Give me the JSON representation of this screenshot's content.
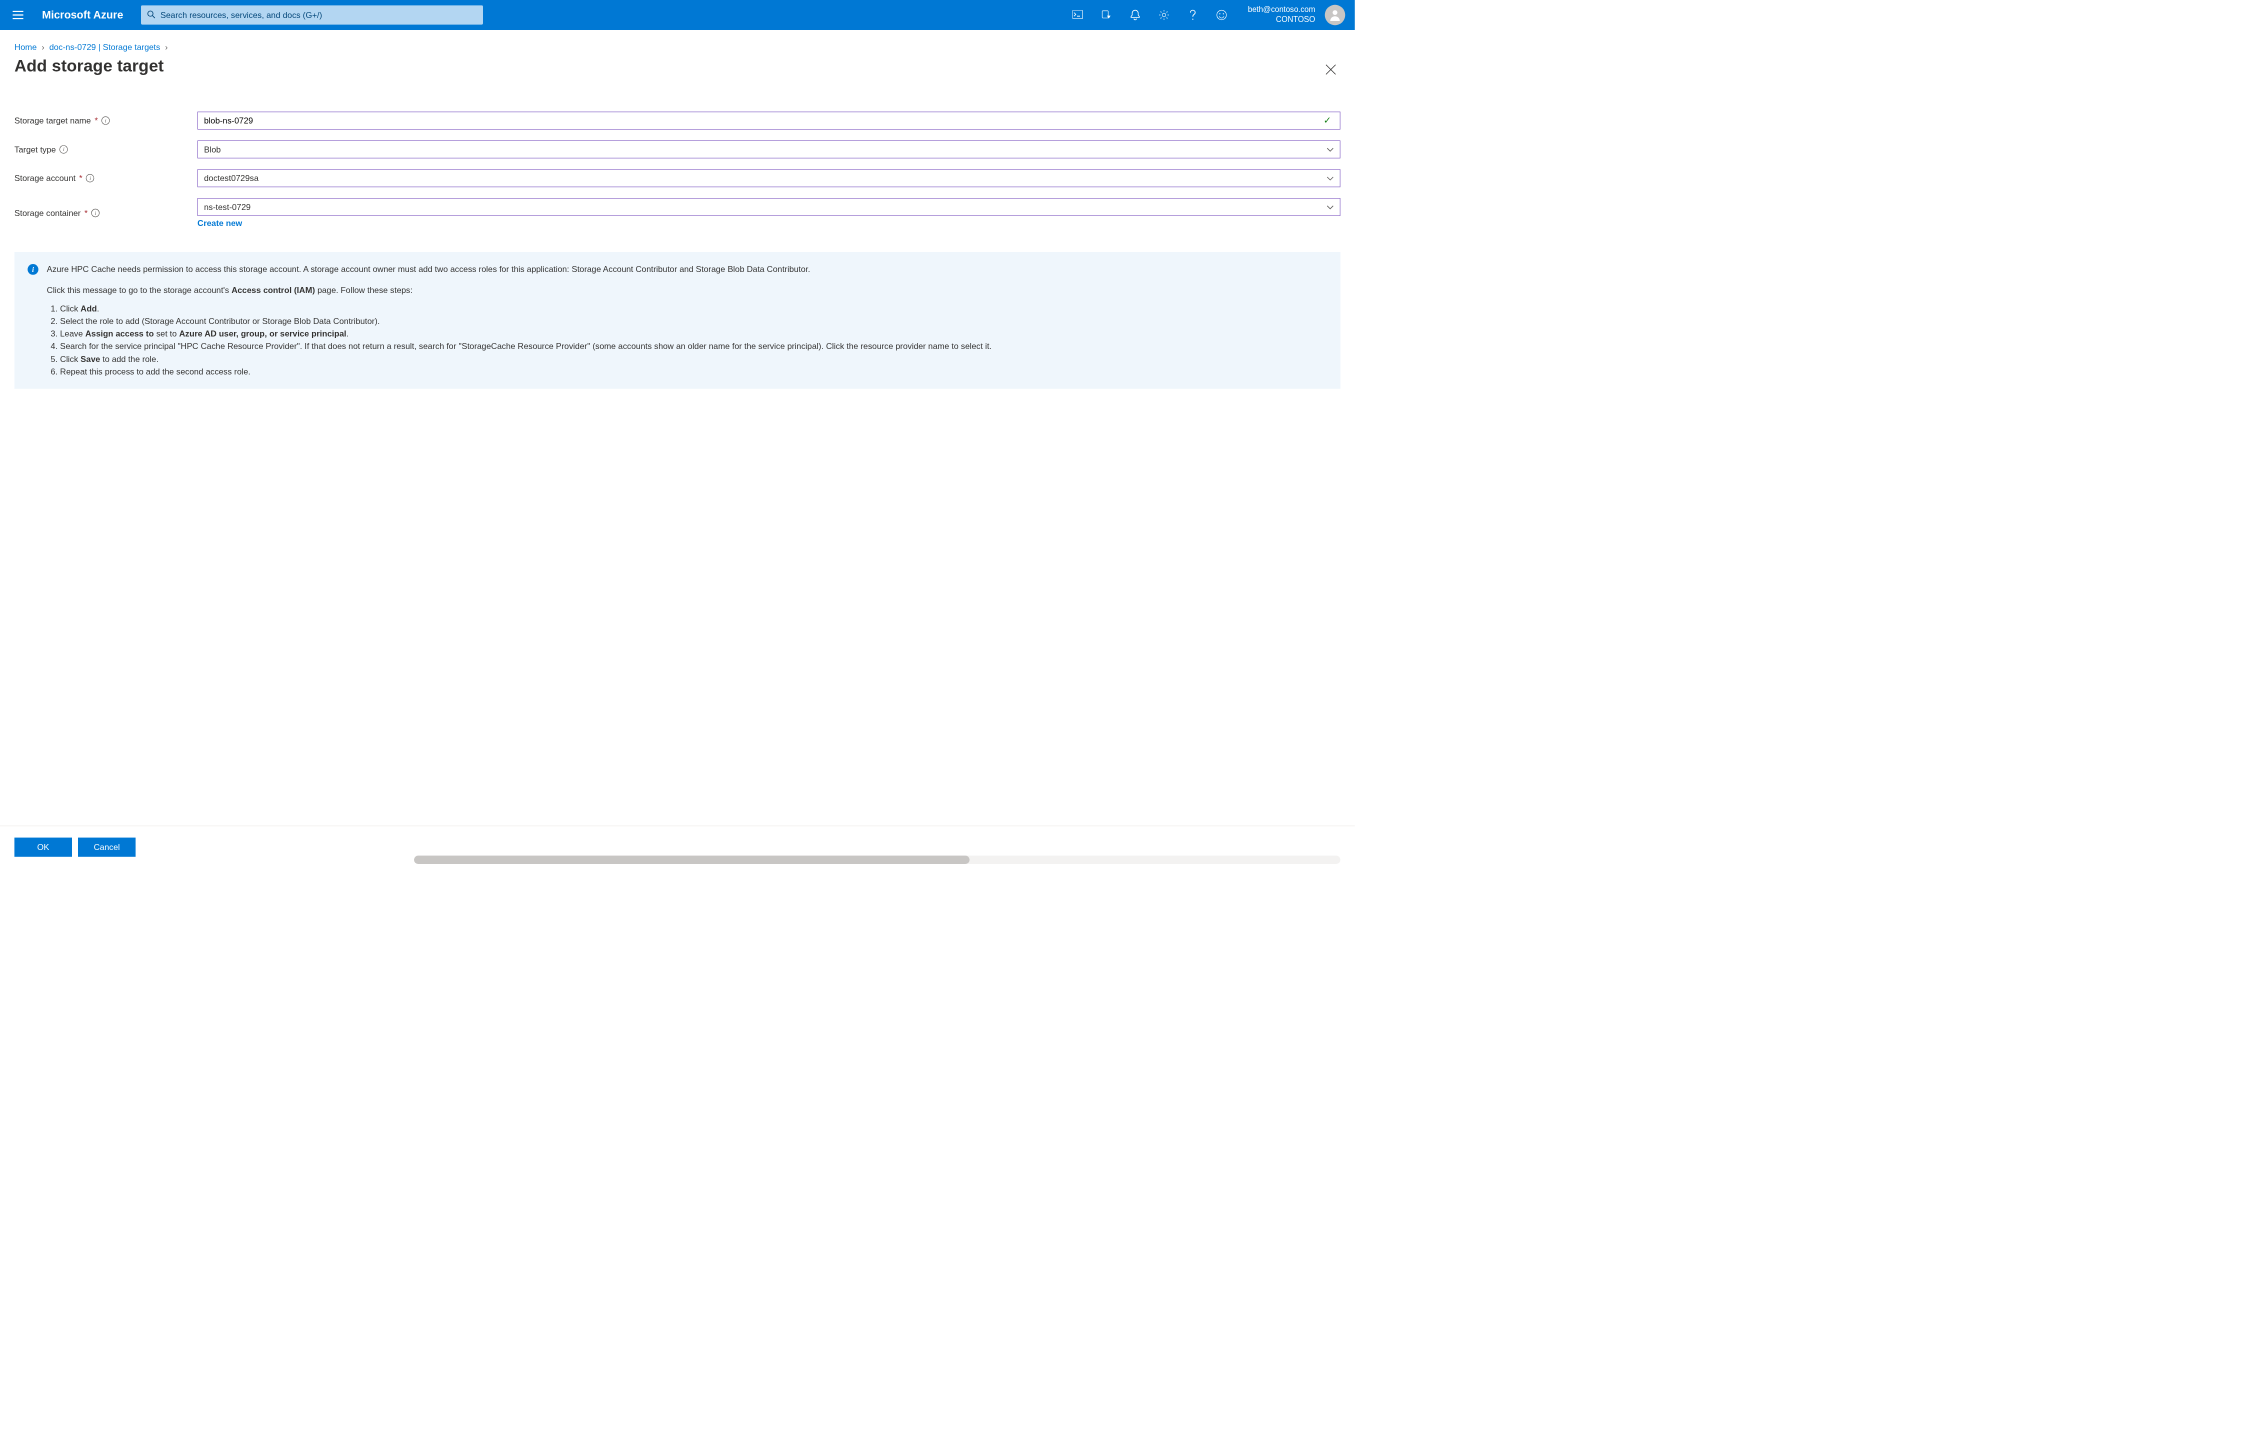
{
  "header": {
    "brand": "Microsoft Azure",
    "search_placeholder": "Search resources, services, and docs (G+/)",
    "account_email": "beth@contoso.com",
    "account_tenant": "CONTOSO"
  },
  "breadcrumb": {
    "home": "Home",
    "item": "doc-ns-0729 | Storage targets"
  },
  "page": {
    "title": "Add storage target"
  },
  "form": {
    "storage_target_name": {
      "label": "Storage target name",
      "value": "blob-ns-0729"
    },
    "target_type": {
      "label": "Target type",
      "value": "Blob"
    },
    "storage_account": {
      "label": "Storage account",
      "value": "doctest0729sa"
    },
    "storage_container": {
      "label": "Storage container",
      "value": "ns-test-0729",
      "create_new": "Create new"
    }
  },
  "info": {
    "intro": "Azure HPC Cache needs permission to access this storage account. A storage account owner must add two access roles for this application: Storage Account Contributor and Storage Blob Data Contributor.",
    "link_line_pre": "Click this message to go to the storage account's ",
    "link_line_bold": "Access control (IAM)",
    "link_line_post": " page. Follow these steps:",
    "steps": {
      "s1_pre": "Click ",
      "s1_bold": "Add",
      "s1_post": ".",
      "s2": "Select the role to add (Storage Account Contributor or Storage Blob Data Contributor).",
      "s3_pre": "Leave ",
      "s3_b1": "Assign access to",
      "s3_mid": " set to ",
      "s3_b2": "Azure AD user, group, or service principal",
      "s3_post": ".",
      "s4": "Search for the service principal \"HPC Cache Resource Provider\". If that does not return a result, search for \"StorageCache Resource Provider\" (some accounts show an older name for the service principal). Click the resource provider name to select it.",
      "s5_pre": "Click ",
      "s5_bold": "Save",
      "s5_post": " to add the role.",
      "s6": "Repeat this process to add the second access role."
    }
  },
  "footer": {
    "ok": "OK",
    "cancel": "Cancel"
  }
}
